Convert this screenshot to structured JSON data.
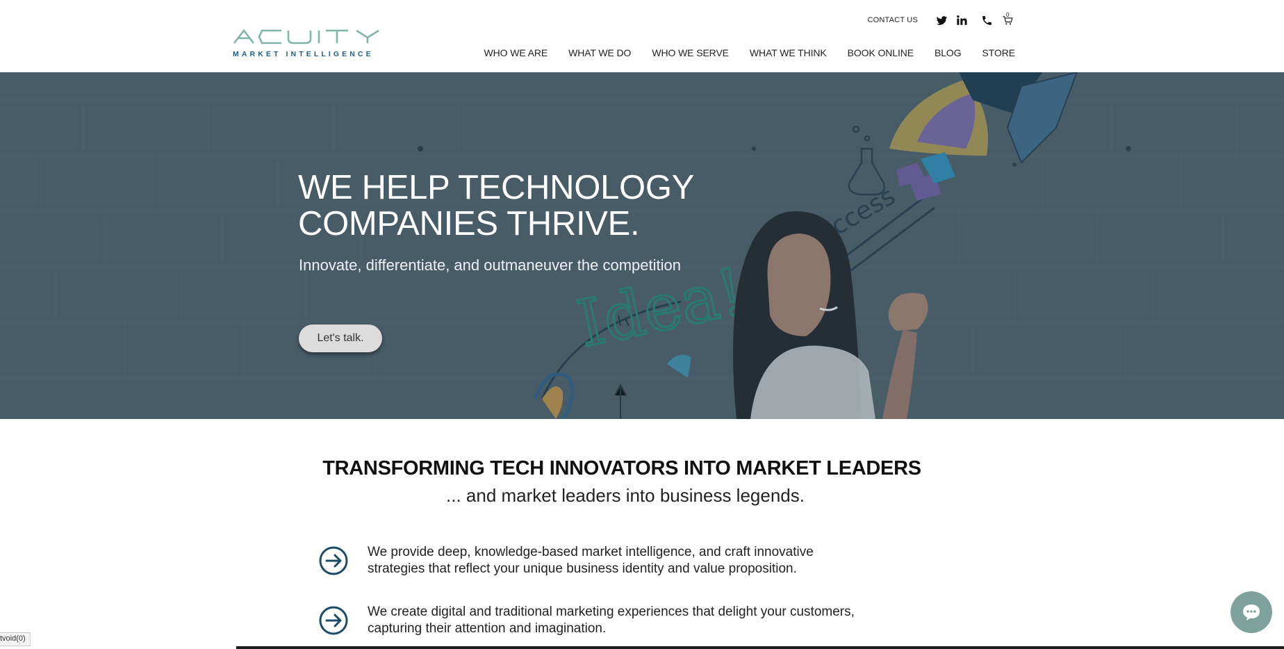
{
  "header": {
    "logo": {
      "wordmark": "ACUITY",
      "subtitle": "MARKET INTELLIGENCE"
    },
    "utility": {
      "contact": "CONTACT US",
      "icons": [
        "twitter-icon",
        "linkedin-icon",
        "phone-icon",
        "cart-icon"
      ],
      "cart_count": "0"
    },
    "nav": [
      {
        "label": "WHO WE ARE"
      },
      {
        "label": "WHAT WE DO"
      },
      {
        "label": "WHO WE SERVE"
      },
      {
        "label": "WHAT WE THINK"
      },
      {
        "label": "BOOK ONLINE"
      },
      {
        "label": "BLOG"
      },
      {
        "label": "STORE"
      }
    ]
  },
  "hero": {
    "title_line1": "WE HELP TECHNOLOGY",
    "title_line2": "COMPANIES THRIVE.",
    "subtitle": "Innovate, differentiate, and outmaneuver the competition",
    "cta": "Let's talk.",
    "illustration": {
      "idea_text": "Idea!",
      "success_text": "ccess"
    }
  },
  "main": {
    "title": "TRANSFORMING TECH INNOVATORS INTO MARKET LEADERS",
    "subtitle": "... and market leaders into business legends.",
    "bullets": [
      {
        "line1": "We provide deep, knowledge-based market intelligence, and craft innovative",
        "line2": "strategies that reflect your unique business identity and value proposition."
      },
      {
        "line1": "We create digital and traditional marketing experiences that delight your customers,",
        "line2": "capturing their attention and imagination."
      }
    ]
  },
  "status_bar": "tvoid(0)",
  "colors": {
    "accent_teal": "#7fb5a8",
    "logo_blue": "#1f5d86",
    "hero_overlay": "#4c5f6a",
    "arrow_navy": "#1c4b66",
    "chat_button": "#7fa19c"
  }
}
